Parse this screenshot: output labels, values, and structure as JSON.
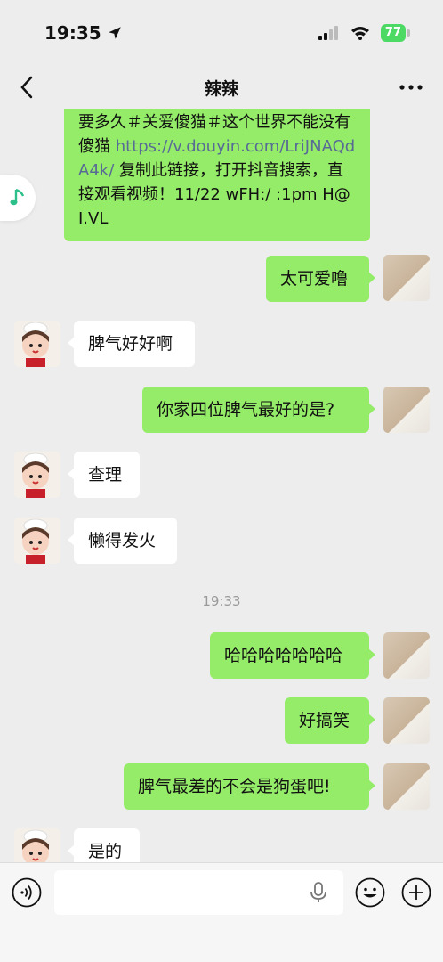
{
  "status_bar": {
    "time": "19:35",
    "battery": "77"
  },
  "nav": {
    "title": "辣辣"
  },
  "messages": {
    "share_text_1": "要多久＃关爱傻猫＃这个世界不能没有傻猫 ",
    "share_link": "https://v.douyin.com/LriJNAQdA4k/",
    "share_text_2": " 复制此链接，打开抖音搜索，直接观看视频！11/22 wFH:/ :1pm H@I.VL",
    "m1": "太可爱噜",
    "m2": "脾气好好啊",
    "m3": "你家四位脾气最好的是?",
    "m4": "查理",
    "m5": "懒得发火",
    "timestamp": "19:33",
    "m6": "哈哈哈哈哈哈哈",
    "m7": "好搞笑",
    "m8": "脾气最差的不会是狗蛋吧!",
    "m9": "是的"
  },
  "input": {
    "placeholder": ""
  },
  "colors": {
    "my_bubble": "#95ec69",
    "their_bubble": "#ffffff",
    "link": "#576b95",
    "background": "#ededed"
  },
  "icons": [
    "location-arrow-icon",
    "signal-icon",
    "wifi-icon",
    "back-icon",
    "more-icon",
    "music-note-icon",
    "voice-icon",
    "mic-icon",
    "emoji-icon",
    "plus-icon"
  ]
}
